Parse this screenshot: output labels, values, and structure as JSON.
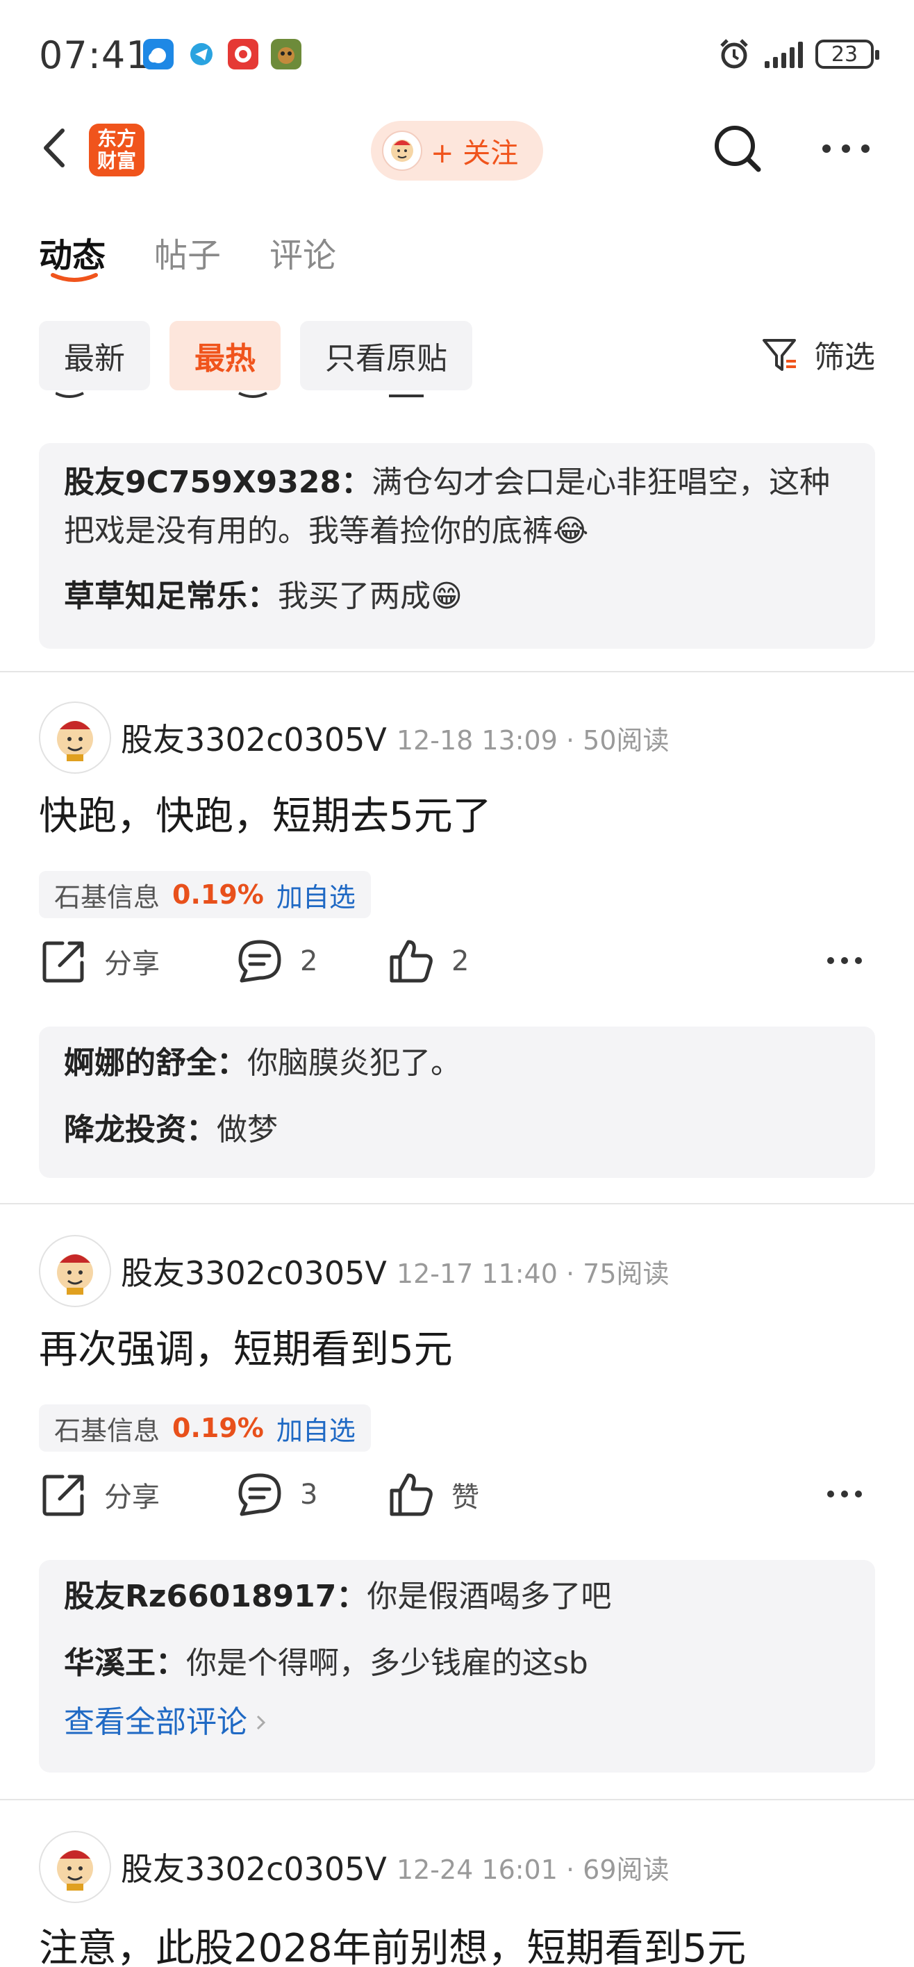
{
  "status_bar": {
    "time": "07:41",
    "battery": "23",
    "icons": [
      "weather-app-icon",
      "telegram-app-icon",
      "red-app-icon",
      "game-app-icon",
      "alarm-icon",
      "signal-icon",
      "battery-icon"
    ]
  },
  "header": {
    "logo_text": [
      "东方",
      "财富"
    ],
    "follow_label": "+ 关注"
  },
  "tabs": [
    {
      "label": "动态",
      "active": true
    },
    {
      "label": "帖子",
      "active": false
    },
    {
      "label": "评论",
      "active": false
    }
  ],
  "filters": [
    {
      "label": "最新",
      "active": false
    },
    {
      "label": "最热",
      "active": true
    },
    {
      "label": "只看原贴",
      "active": false
    }
  ],
  "filter_button": "筛选",
  "colors": {
    "accent": "#f0541c",
    "accent_bg": "#fde6dc",
    "link": "#1f69c4",
    "up": "#e8501b",
    "chip_bg": "#f3f3f5"
  },
  "feed": {
    "first_comments": [
      {
        "user": "股友9C759X9328",
        "text": "满仓勾才会口是心非狂唱空，这种把戏是没有用的。我等着捡你的底裤😂"
      },
      {
        "user": "草草知足常乐",
        "text": "我买了两成😁"
      }
    ],
    "posts": [
      {
        "author": "股友3302c0305V",
        "meta": "12-18 13:09 · 50阅读",
        "content": "快跑，快跑，短期去5元了",
        "stock": {
          "name": "石基信息",
          "change": "0.19%",
          "add": "加自选"
        },
        "share": "分享",
        "comment_count": "2",
        "like_count": "2",
        "comments": [
          {
            "user": "婀娜的舒全",
            "text": "你脑膜炎犯了。"
          },
          {
            "user": "降龙投资",
            "text": "做梦"
          }
        ]
      },
      {
        "author": "股友3302c0305V",
        "meta": "12-17 11:40 · 75阅读",
        "content": "再次强调，短期看到5元",
        "stock": {
          "name": "石基信息",
          "change": "0.19%",
          "add": "加自选"
        },
        "share": "分享",
        "comment_count": "3",
        "like_count": "赞",
        "comments": [
          {
            "user": "股友Rz66018917",
            "text": "你是假酒喝多了吧"
          },
          {
            "user": "华溪王",
            "text": "你是个得啊，多少钱雇的这sb"
          }
        ],
        "view_all": "查看全部评论"
      },
      {
        "author": "股友3302c0305V",
        "meta": "12-24 16:01 · 69阅读",
        "content": "注意，此股2028年前别想，短期看到5元"
      }
    ]
  }
}
